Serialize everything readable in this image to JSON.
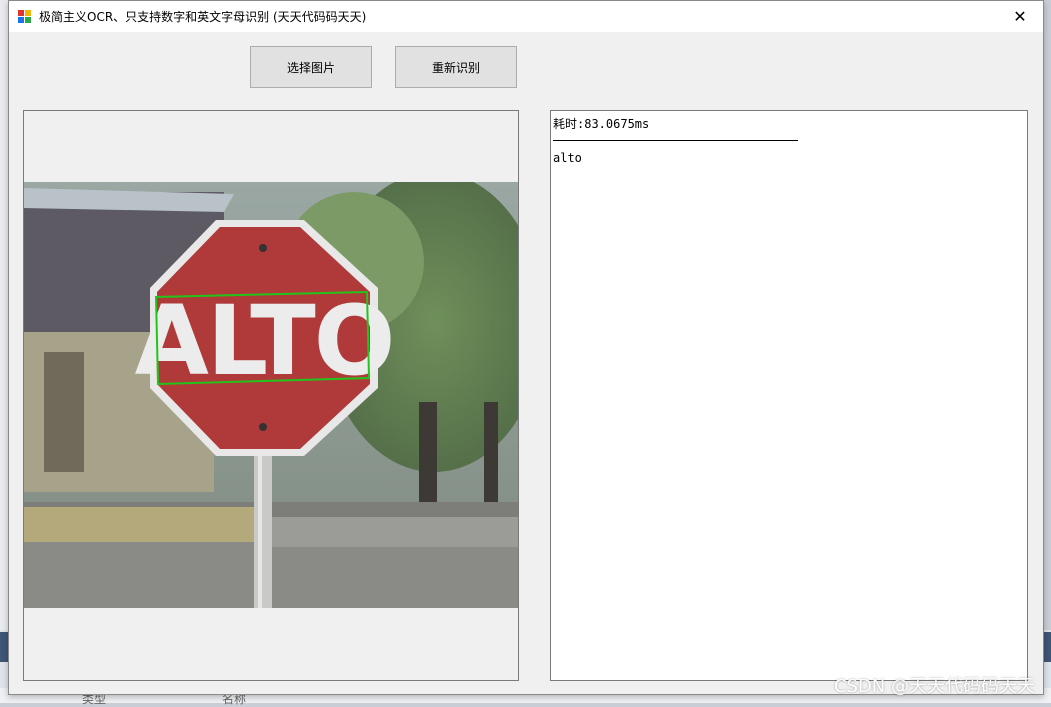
{
  "window": {
    "title": "极简主义OCR、只支持数字和英文字母识别 (天天代码码天天)",
    "close_glyph": "✕"
  },
  "toolbar": {
    "select_image_label": "选择图片",
    "recognize_again_label": "重新识别"
  },
  "image": {
    "sign_text": "ALTO",
    "detection_box_color": "#22c41a"
  },
  "result": {
    "time_line": "耗时:83.0675ms",
    "recognized_text": "alto"
  },
  "watermark": "CSDN @天天代码码天天",
  "background": {
    "label_type": "类型",
    "label_name": "名称"
  },
  "colors": {
    "sign_red": "#b03a3a",
    "detection_green": "#22c41a"
  }
}
